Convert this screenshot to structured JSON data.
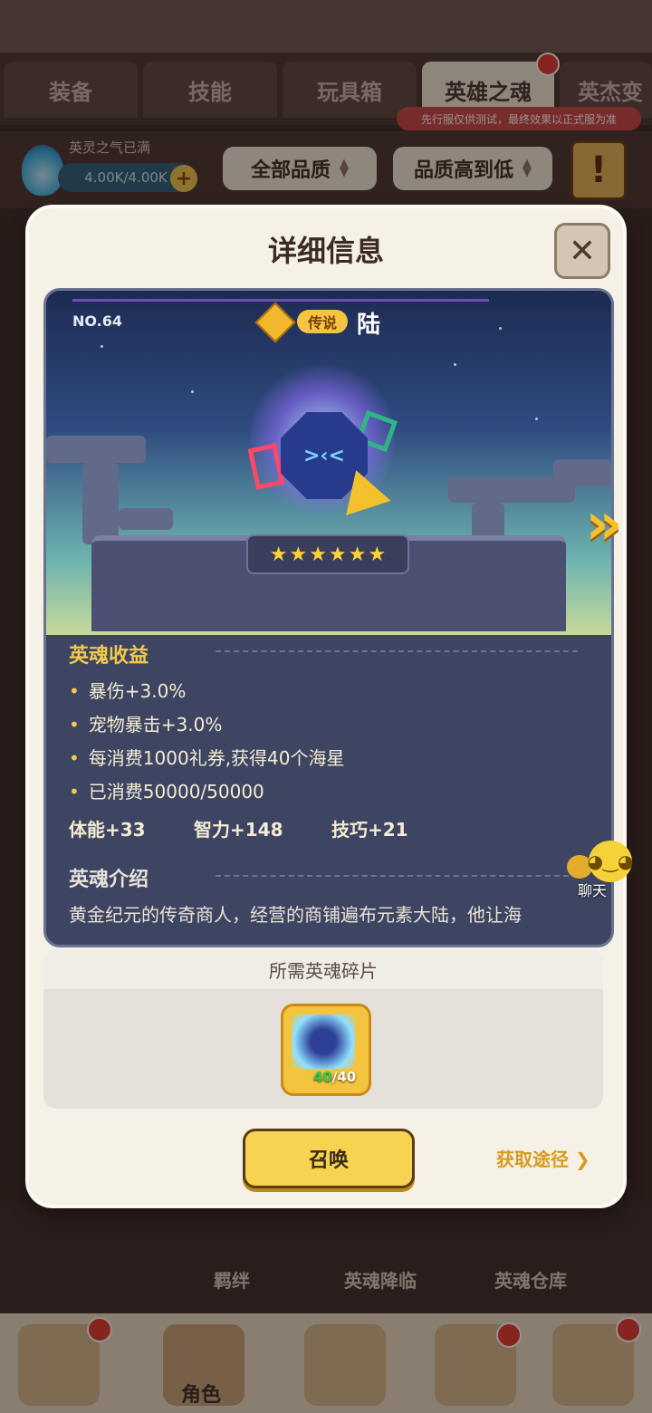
{
  "tabs": [
    {
      "label": "装备"
    },
    {
      "label": "技能"
    },
    {
      "label": "玩具箱"
    },
    {
      "label": "英雄之魂",
      "active": true
    },
    {
      "label": "英杰变"
    }
  ],
  "test_notice": "先行服仅供测试，最终效果以正式服为准",
  "resource": {
    "label": "英灵之气已满",
    "value": "4.00K/4.00K",
    "plus": "+"
  },
  "filters": {
    "quality": "全部品质",
    "sort": "品质高到低"
  },
  "alert_icon_text": "!",
  "modal": {
    "title": "详细信息",
    "close_symbol": "✕",
    "number": "NO.64",
    "rarity": "传说",
    "name": "陆",
    "star_count": 6,
    "crystal_face": ">‹<",
    "next_symbol": "»",
    "benefit_title": "英魂收益",
    "benefits": [
      "暴伤+3.0%",
      "宠物暴击+3.0%",
      "每消费1000礼券,获得40个海星",
      "已消费50000/50000"
    ],
    "attributes": [
      "体能+33",
      "智力+148",
      "技巧+21"
    ],
    "intro_title": "英魂介绍",
    "intro_text": "黄金纪元的传奇商人，经营的商铺遍布元素大陆，他让海",
    "chat_label": "聊天",
    "fragment_title": "所需英魂碎片",
    "fragment_have": "40",
    "fragment_need": "/40",
    "summon_label": "召唤",
    "obtain_label": "获取途径",
    "obtain_arrow": "❯"
  },
  "bottom_menu": [
    "羁绊",
    "英魂降临",
    "英魂仓库"
  ],
  "nav": {
    "active_label": "角色"
  },
  "colors": {
    "accent_gold": "#f2c94c",
    "panel_bg": "#3e4563",
    "modal_bg": "#f6f1e6",
    "alert_red": "#e33b2e"
  }
}
